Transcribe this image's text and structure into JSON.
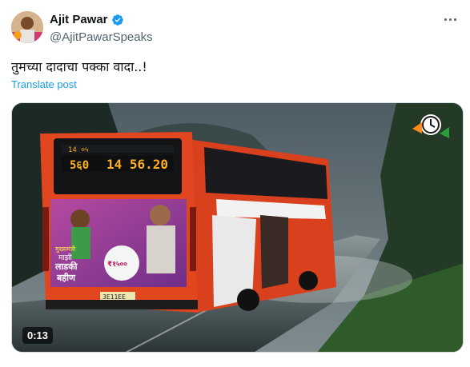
{
  "author": {
    "name": "Ajit Pawar",
    "handle": "@AjitPawarSpeaks",
    "verified": true
  },
  "post": {
    "text": "तुमच्या दादाचा पक्का वादा..!",
    "translate_label": "Translate post"
  },
  "video": {
    "duration": "0:13",
    "bus_display_route": "14 56.20",
    "bus_display_left": "5६0",
    "ad_line1": "मुख्यमंत्री",
    "ad_line2": "माझी",
    "ad_line3": "लाडकी",
    "ad_line4": "बहीण",
    "ad_amount": "₹१५००",
    "bus_plate": "3E11EE"
  },
  "colors": {
    "link": "#1d9bf0",
    "verified": "#1d9bf0",
    "bus_body": "#d9401d"
  }
}
